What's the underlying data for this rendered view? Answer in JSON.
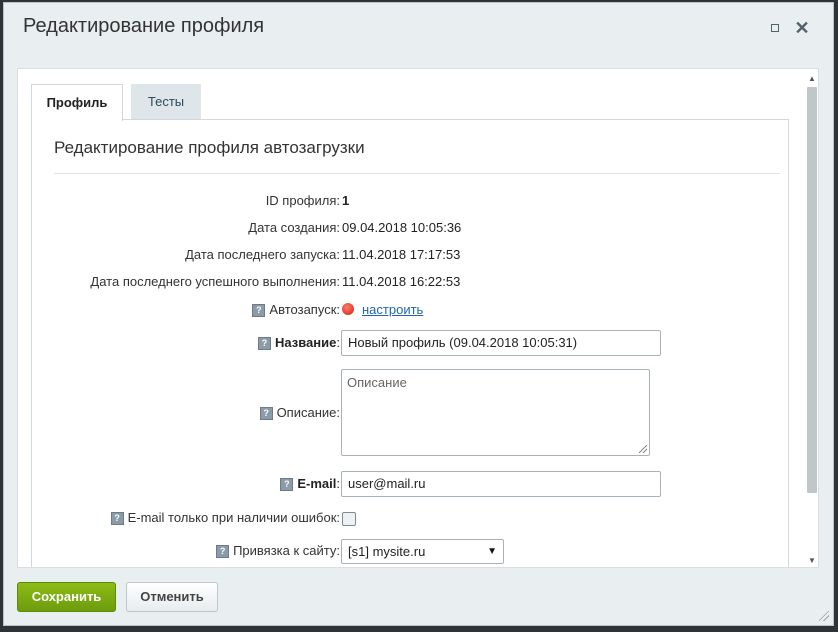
{
  "dialog": {
    "title": "Редактирование профиля"
  },
  "tabs": [
    {
      "label": "Профиль",
      "active": true
    },
    {
      "label": "Тесты",
      "active": false
    }
  ],
  "section": {
    "title": "Редактирование профиля автозагрузки"
  },
  "fields": {
    "profile_id": {
      "label": "ID профиля:",
      "value": "1"
    },
    "created": {
      "label": "Дата создания:",
      "value": "09.04.2018 10:05:36"
    },
    "last_run": {
      "label": "Дата последнего запуска:",
      "value": "11.04.2018 17:17:53"
    },
    "last_success": {
      "label": "Дата последнего успешного выполнения:",
      "value": "11.04.2018 16:22:53"
    },
    "autorun": {
      "label": "Автозапуск:",
      "link": "настроить",
      "status_color": "#d21f12"
    },
    "name": {
      "label": "Название",
      "value": "Новый профиль (09.04.2018 10:05:31)"
    },
    "description": {
      "label": "Описание:",
      "placeholder": "Описание"
    },
    "email": {
      "label": "E-mail",
      "value": "user@mail.ru"
    },
    "email_errors_only": {
      "label": "E-mail только при наличии ошибок:",
      "checked": false
    },
    "site": {
      "label": "Привязка к сайту:",
      "selected": "[s1] mysite.ru"
    }
  },
  "help_icon_text": "?",
  "buttons": {
    "save": "Сохранить",
    "cancel": "Отменить"
  },
  "colors": {
    "save_button": "#7aab10",
    "link": "#2067b0"
  }
}
